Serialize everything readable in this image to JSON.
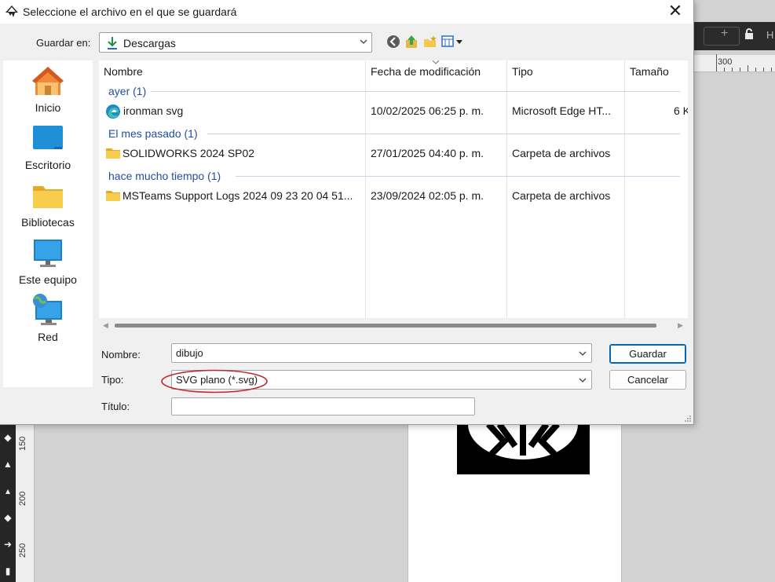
{
  "dialog": {
    "title": "Seleccione el archivo en el que se guardará",
    "close_symbol": "✕",
    "icon": "inkscape-icon"
  },
  "save_in": {
    "label": "Guardar en:",
    "value": "Descargas",
    "icon": "download-icon"
  },
  "nav_icons": [
    "back-icon",
    "up-folder-icon",
    "new-folder-icon",
    "view-menu-icon"
  ],
  "places": [
    {
      "label": "Inicio",
      "icon": "home-icon"
    },
    {
      "label": "Escritorio",
      "icon": "desktop-icon"
    },
    {
      "label": "Bibliotecas",
      "icon": "libraries-icon"
    },
    {
      "label": "Este equipo",
      "icon": "computer-icon"
    },
    {
      "label": "Red",
      "icon": "network-icon"
    }
  ],
  "file_list": {
    "columns": [
      "Nombre",
      "Fecha de modificación",
      "Tipo",
      "Tamaño"
    ],
    "groups": [
      {
        "title": "ayer (1)",
        "rows": [
          {
            "name": "ironman svg",
            "date": "10/02/2025 06:25 p. m.",
            "type": "Microsoft Edge HT...",
            "size": "6 K",
            "icon": "edge-icon"
          }
        ]
      },
      {
        "title": "El mes pasado (1)",
        "rows": [
          {
            "name": "SOLIDWORKS 2024 SP02",
            "date": "27/01/2025 04:40 p. m.",
            "type": "Carpeta de archivos",
            "size": "",
            "icon": "folder-icon"
          }
        ]
      },
      {
        "title": "hace mucho tiempo (1)",
        "rows": [
          {
            "name": "MSTeams Support Logs 2024 09 23 20 04 51...",
            "date": "23/09/2024 02:05 p. m.",
            "type": "Carpeta de archivos",
            "size": "",
            "icon": "folder-icon"
          }
        ]
      }
    ]
  },
  "form": {
    "name_label": "Nombre:",
    "name_value": "dibujo",
    "type_label": "Tipo:",
    "type_value": "SVG plano (*.svg)",
    "title_label": "Título:",
    "title_value": ""
  },
  "buttons": {
    "save": "Guardar",
    "cancel": "Cancelar"
  },
  "background_app": {
    "ruler_top_label": "300",
    "ruler_left_labels": [
      "150",
      "200",
      "250"
    ],
    "toolbar_h_label": "H"
  },
  "colors": {
    "accent": "#0067c0",
    "group_title": "#1f4e9e",
    "annotation_red": "#c0282d"
  }
}
